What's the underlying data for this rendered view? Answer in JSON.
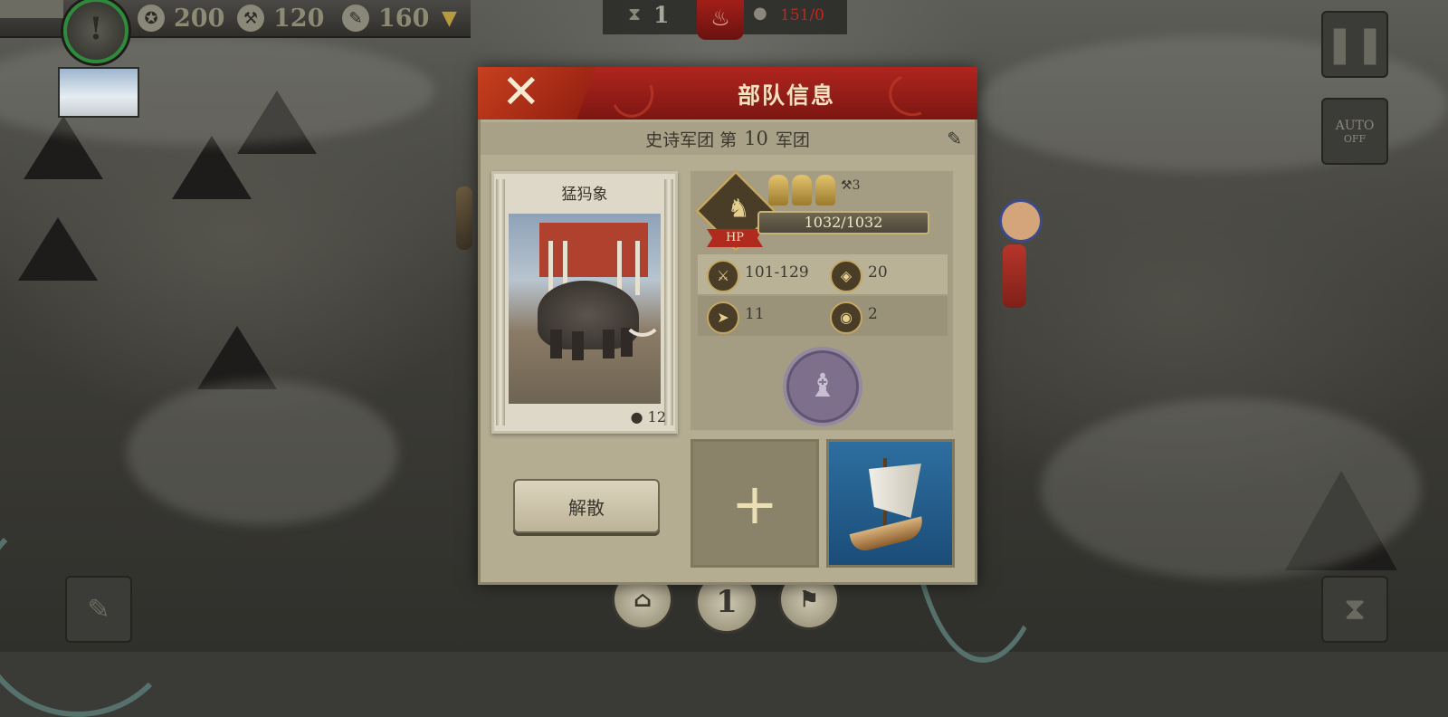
{
  "hud": {
    "resources": [
      {
        "icon": "medal-icon",
        "value": "200"
      },
      {
        "icon": "hammer-icon",
        "value": "120"
      },
      {
        "icon": "scroll-icon",
        "value": "160"
      }
    ],
    "turn_count": "1",
    "population": "151/0",
    "auto_button": {
      "label": "AUTO",
      "state": "OFF"
    }
  },
  "dialog": {
    "title": "部队信息",
    "subtitle_prefix": "史诗军团 第",
    "legion_number": "10",
    "subtitle_suffix": "军团",
    "unit": {
      "name": "猛犸象",
      "count": "12",
      "hp": "1032/1032",
      "hp_label": "HP",
      "rank_level": "3",
      "stats": [
        {
          "icon": "attack-icon",
          "value": "101-129"
        },
        {
          "icon": "armor-icon",
          "value": "20"
        },
        {
          "icon": "movement-icon",
          "value": "11"
        },
        {
          "icon": "vision-icon",
          "value": "2"
        }
      ],
      "skill_icon": "mammoth-skill-icon"
    },
    "disband_label": "解散",
    "slots": [
      {
        "type": "empty",
        "icon": "add-siege-icon"
      },
      {
        "type": "transport-ship",
        "icon": "ship-icon"
      }
    ]
  },
  "map": {
    "bottom_center_label": "1"
  },
  "colors": {
    "header_red": "#a21f1a",
    "panel_bg": "#b5ad92",
    "gold": "#c2a764"
  }
}
